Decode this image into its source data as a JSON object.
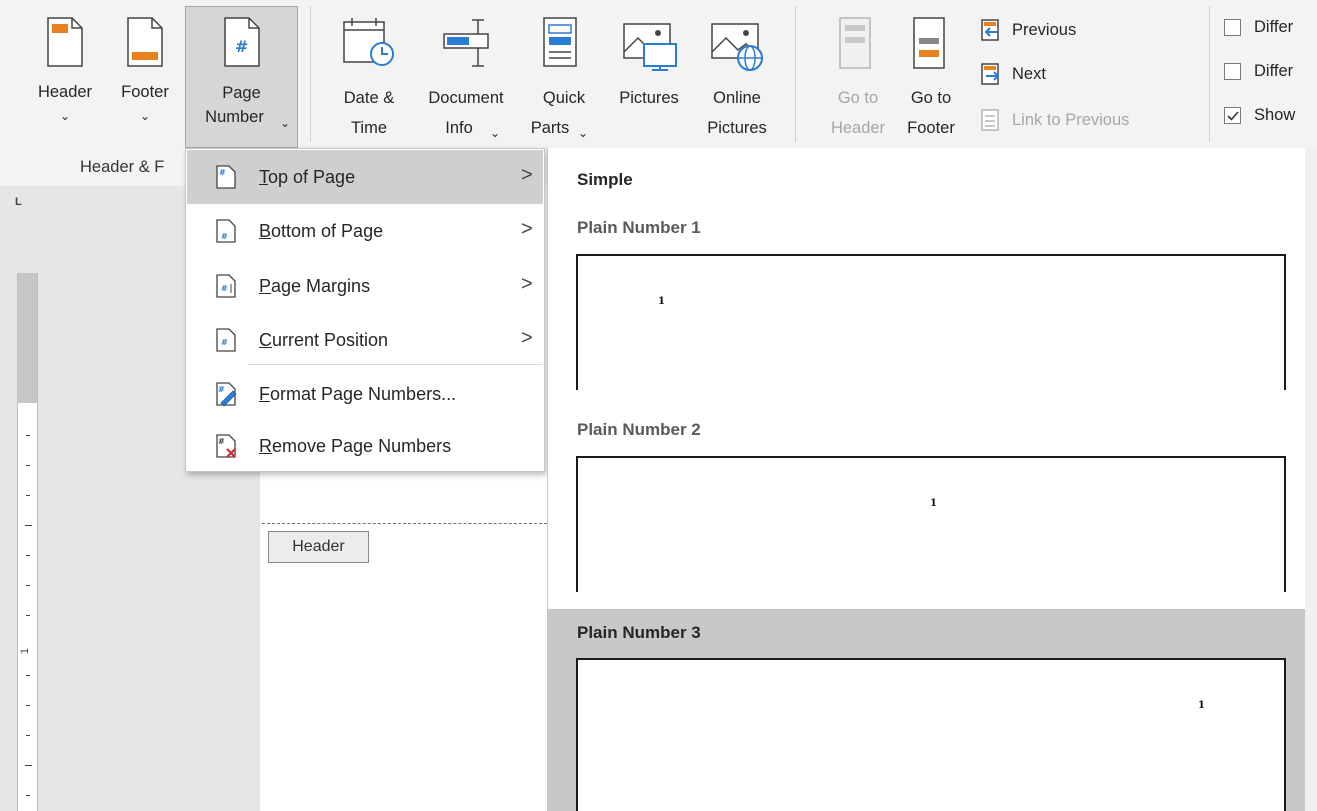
{
  "ribbon": {
    "header": {
      "label": "Header",
      "chevron": "⌄"
    },
    "footer": {
      "label": "Footer",
      "chevron": "⌄"
    },
    "page_number": {
      "line1": "Page",
      "line2": "Number",
      "chevron": "⌄"
    },
    "date_time": {
      "line1": "Date &",
      "line2": "Time"
    },
    "document_info": {
      "line1": "Document",
      "line2": "Info",
      "chevron": "⌄"
    },
    "quick_parts": {
      "line1": "Quick",
      "line2": "Parts",
      "chevron": "⌄"
    },
    "pictures": {
      "label": "Pictures"
    },
    "online_pictures": {
      "line1": "Online",
      "line2": "Pictures"
    },
    "go_to_header": {
      "line1": "Go to",
      "line2": "Header"
    },
    "go_to_footer": {
      "line1": "Go to",
      "line2": "Footer"
    },
    "previous": "Previous",
    "next": "Next",
    "link_to_previous": "Link to Previous",
    "options": [
      {
        "label": "Differ",
        "checked": false
      },
      {
        "label": "Differ",
        "checked": false
      },
      {
        "label": "Show",
        "checked": true
      }
    ],
    "group_label": "Header & F"
  },
  "menu": {
    "items": [
      {
        "label": "Top of Page",
        "accel": "T",
        "rest": "op of Page",
        "icon": "page-top-number-icon",
        "submenu": true,
        "highlighted": true
      },
      {
        "label": "Bottom of Page",
        "accel": "B",
        "rest": "ottom of Page",
        "icon": "page-bottom-number-icon",
        "submenu": true
      },
      {
        "label": "Page Margins",
        "accel": "P",
        "rest": "age Margins",
        "icon": "page-margin-number-icon",
        "submenu": true
      },
      {
        "label": "Current Position",
        "accel": "C",
        "rest": "urrent Position",
        "icon": "page-current-number-icon",
        "submenu": true
      },
      {
        "label": "Format Page Numbers...",
        "accel": "F",
        "rest": "ormat Page Numbers...",
        "icon": "format-page-numbers-icon",
        "submenu": false
      },
      {
        "label": "Remove Page Numbers",
        "accel": "R",
        "rest": "emove Page Numbers",
        "icon": "remove-page-numbers-icon",
        "submenu": false
      }
    ],
    "arrow": ">"
  },
  "gallery": {
    "heading": "Simple",
    "items": [
      {
        "title": "Plain Number 1",
        "number": "1",
        "align": "left"
      },
      {
        "title": "Plain Number 2",
        "number": "1",
        "align": "center"
      },
      {
        "title": "Plain Number 3",
        "number": "1",
        "align": "right",
        "hovered": true
      }
    ]
  },
  "document": {
    "header_tag": "Header"
  },
  "ruler": {
    "corner": "L",
    "mark": "1"
  },
  "colors": {
    "ribbon_bg": "#f3f3f3",
    "accent_blue": "#2b7cd3",
    "accent_orange": "#e8821c",
    "hover_gray": "#cfcfcf"
  }
}
